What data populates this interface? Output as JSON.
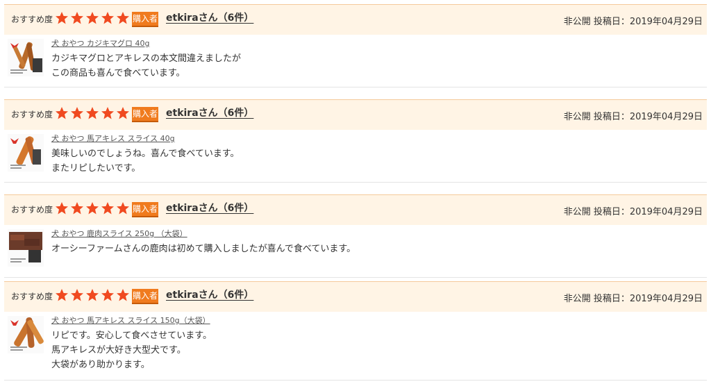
{
  "reviews": [
    {
      "rec_label": "おすすめ度",
      "stars": 5,
      "badge": "購入者",
      "user": "etkiraさん（6件）",
      "meta": "非公開 投稿日：2019年04月29日",
      "product": "犬 おやつ カジキマグロ 40g",
      "comment": "カジキマグロとアキレスの本文間違えましたが\nこの商品も喜んで食べています。"
    },
    {
      "rec_label": "おすすめ度",
      "stars": 5,
      "badge": "購入者",
      "user": "etkiraさん（6件）",
      "meta": "非公開 投稿日：2019年04月29日",
      "product": "犬 おやつ 馬アキレス スライス 40g",
      "comment": "美味しいのでしょうね。喜んで食べています。\nまたリピしたいです。"
    },
    {
      "rec_label": "おすすめ度",
      "stars": 5,
      "badge": "購入者",
      "user": "etkiraさん（6件）",
      "meta": "非公開 投稿日：2019年04月29日",
      "product": "犬 おやつ 鹿肉スライス 250g （大袋）",
      "comment": "オーシーファームさんの鹿肉は初めて購入しましたが喜んで食べています。"
    },
    {
      "rec_label": "おすすめ度",
      "stars": 5,
      "badge": "購入者",
      "user": "etkiraさん（6件）",
      "meta": "非公開 投稿日：2019年04月29日",
      "product": "犬 おやつ 馬アキレス スライス 150g（大袋）",
      "comment": "リピです。安心して食べさせています。\n馬アキレスが大好き大型犬です。\n大袋があり助かります。"
    }
  ],
  "colors": {
    "header_bg": "#fff4e5",
    "star": "#f04a20",
    "badge": "#f07b1e"
  },
  "icons": {
    "star": "star-icon",
    "product": "product-thumbnail-image"
  }
}
